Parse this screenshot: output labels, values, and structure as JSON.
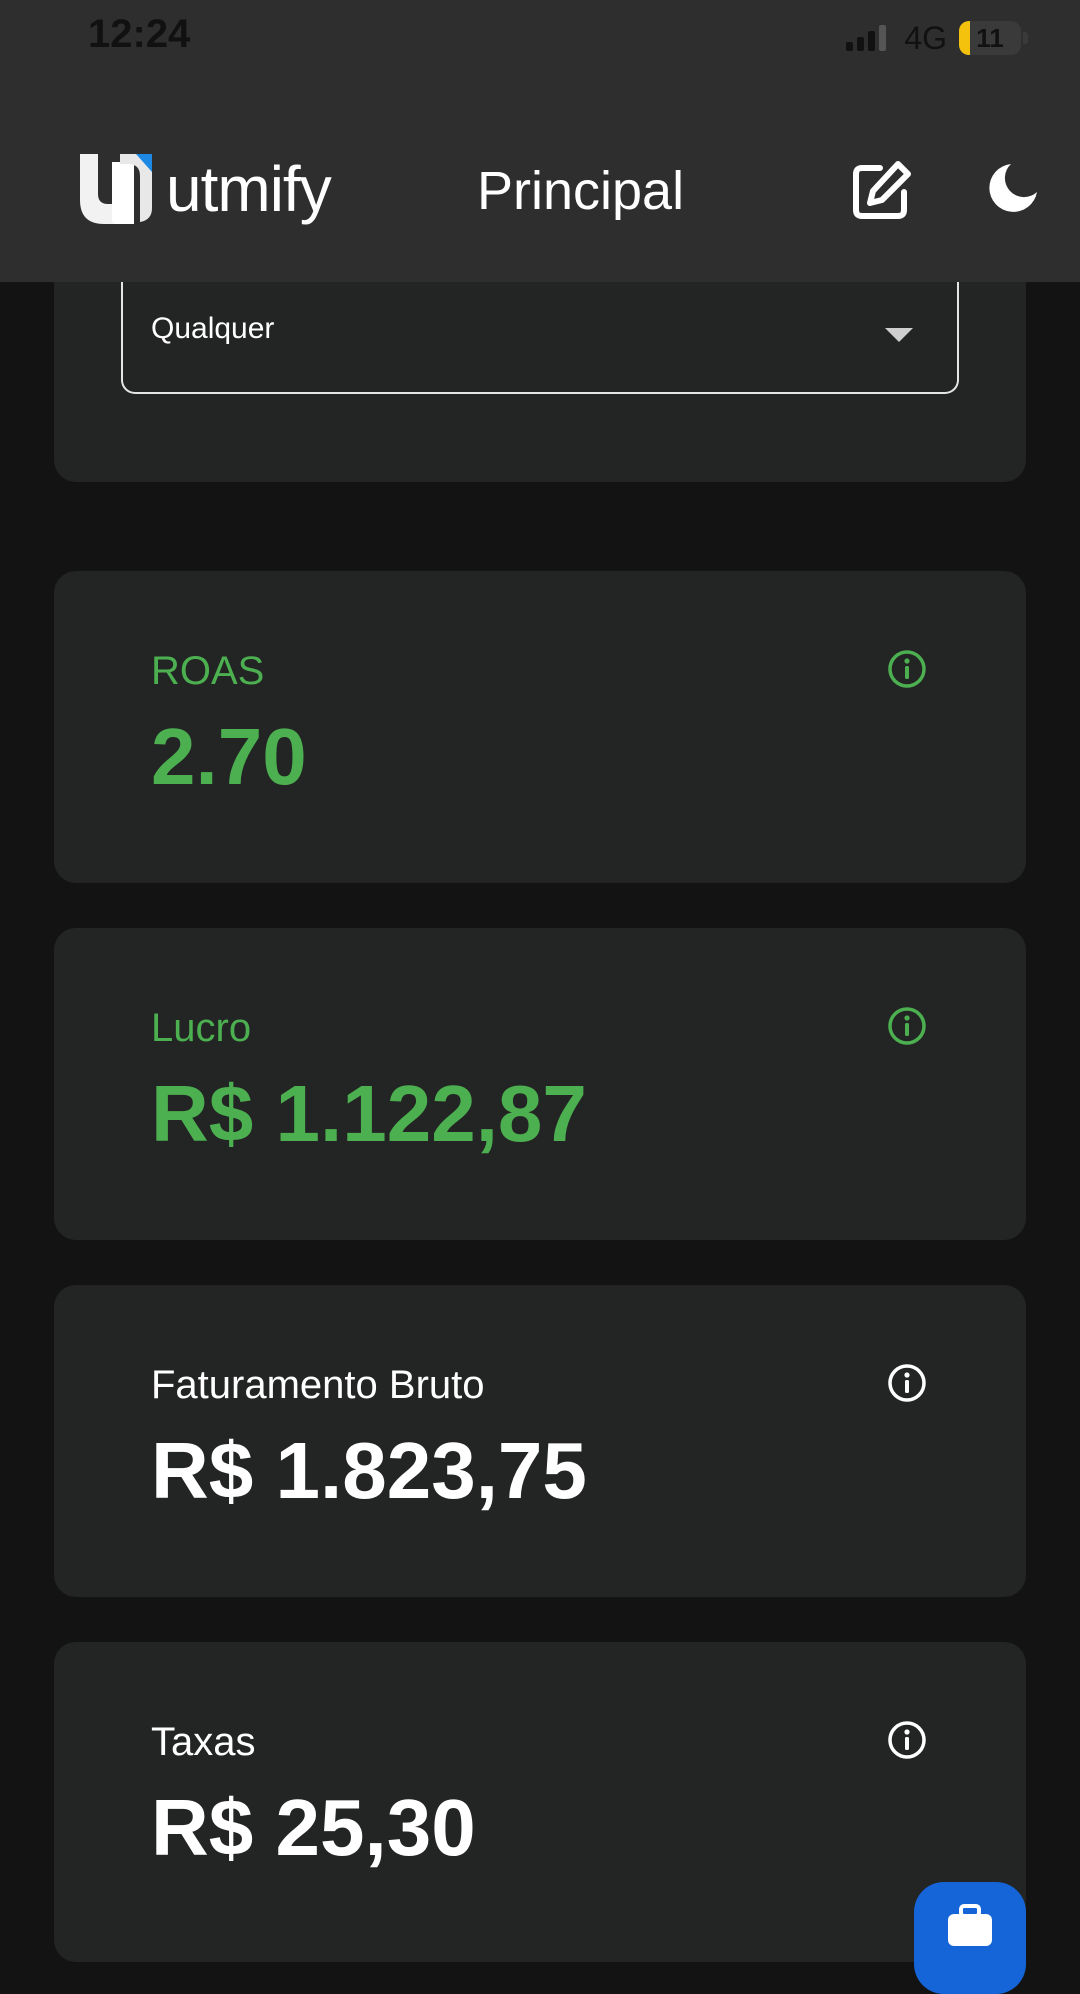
{
  "status_bar": {
    "time": "12:24",
    "network": "4G",
    "battery": "11"
  },
  "header": {
    "logo_text": "utmify",
    "title": "Principal"
  },
  "filter": {
    "selected": "Qualquer"
  },
  "metrics": [
    {
      "label": "ROAS",
      "value": "2.70",
      "color": "#4caf50"
    },
    {
      "label": "Lucro",
      "value": "R$ 1.122,87",
      "color": "#4caf50"
    },
    {
      "label": "Faturamento Bruto",
      "value": "R$ 1.823,75",
      "color": "#ffffff"
    },
    {
      "label": "Taxas",
      "value": "R$ 25,30",
      "color": "#ffffff"
    }
  ],
  "colors": {
    "accent_green": "#4caf50",
    "fab_blue": "#1565d8",
    "battery_yellow": "#f4c20d"
  }
}
